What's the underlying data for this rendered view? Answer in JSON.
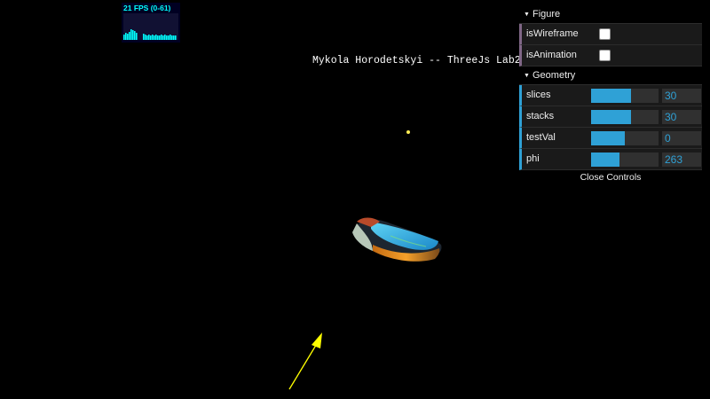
{
  "stats": {
    "fps_text": "21 FPS (0-61)",
    "fps": 21,
    "fps_min": 0,
    "fps_max": 61
  },
  "title": "Mykola Horodetskyi -- ThreeJs Lab2",
  "colors": {
    "slider_fill": "#2fa1d6",
    "bool_stripe": "#806787",
    "value_text": "#2fa1d6",
    "arrow": "#ffff00"
  },
  "gui": {
    "figure": {
      "title": "Figure",
      "controls": [
        {
          "label": "isWireframe",
          "checked": false
        },
        {
          "label": "isAnimation",
          "checked": false
        }
      ]
    },
    "geometry": {
      "title": "Geometry",
      "controls": [
        {
          "label": "slices",
          "value": "30",
          "fill_fraction": 0.59
        },
        {
          "label": "stacks",
          "value": "30",
          "fill_fraction": 0.59
        },
        {
          "label": "testVal",
          "value": "0",
          "fill_fraction": 0.5
        },
        {
          "label": "phi",
          "value": "263",
          "fill_fraction": 0.42
        }
      ]
    },
    "close_label": "Close Controls"
  },
  "scene": {
    "objects": [
      "parametric-surface",
      "point-light",
      "arrow-helper"
    ]
  }
}
